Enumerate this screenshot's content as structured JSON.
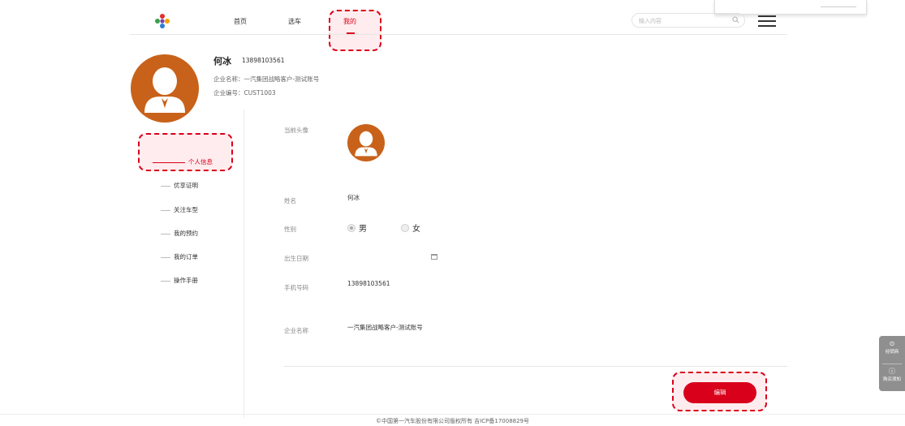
{
  "header": {
    "nav": [
      {
        "label": "首页"
      },
      {
        "label": "选车"
      },
      {
        "label": "我的"
      }
    ],
    "search_placeholder": "输入内容",
    "accent_color": "#d9001b"
  },
  "profile": {
    "name": "何冰",
    "phone": "13898103561",
    "company_line": "企业名称：一汽集团战略客户-测试账号",
    "company_code_line": "企业编号：CUST1003",
    "avatar_color": "#c8621a"
  },
  "sidebar": {
    "items": [
      {
        "label": "个人信息",
        "active": true
      },
      {
        "label": "优享证明"
      },
      {
        "label": "关注车型"
      },
      {
        "label": "我的预约"
      },
      {
        "label": "我的订单"
      },
      {
        "label": "操作手册"
      }
    ]
  },
  "form": {
    "avatar_label": "当前头像",
    "name_label": "姓名",
    "name_value": "何冰",
    "gender_label": "性别",
    "gender_options": [
      "男",
      "女"
    ],
    "gender_selected": "男",
    "birthday_label": "出生日期",
    "birthday_value": "",
    "phone_label": "手机号码",
    "phone_value": "13898103561",
    "company_label": "企业名称",
    "company_value": "一汽集团战略客户-测试账号",
    "edit_button": "编辑"
  },
  "float_bar": {
    "dealer": "经销商",
    "purchase_notice": "购买须知"
  },
  "footer": {
    "copyright": "©中国第一汽车股份有限公司版权所有 吉ICP备17008829号"
  }
}
